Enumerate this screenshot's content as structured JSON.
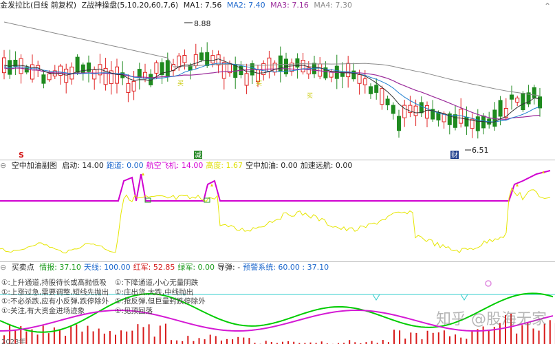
{
  "main_panel": {
    "stock_name": "金发拉比(日线 前复权)",
    "indicator": "Z战神操盘(5,10,20,60,7,6)",
    "ma1": "MA1: 7.56",
    "ma2": "MA2: 7.40",
    "ma3": "MA3: 7.16",
    "ma4": "MA4: 7.30",
    "high_label": "8.88",
    "low_label": "6.51",
    "marker_s": "S",
    "marker_jian": "减",
    "marker_cai": "财",
    "buy_mark": "买"
  },
  "sub_panel1": {
    "title": "空中加油副图",
    "items": [
      {
        "label": "启动: 14.00",
        "color": "#222222"
      },
      {
        "label": "跑道: 0.00",
        "color": "#1a66cc"
      },
      {
        "label": "航空飞机: 14.00",
        "color": "#d400d4"
      },
      {
        "label": "高度: 1.67",
        "color": "#dede00"
      },
      {
        "label": "空中加油: 0.00",
        "color": "#222222"
      },
      {
        "label": "加速远航: 0.00",
        "color": "#222222"
      }
    ]
  },
  "sub_panel2": {
    "title": "买卖点",
    "items": [
      {
        "label": "情报: 37.10",
        "color": "#1a9a1a"
      },
      {
        "label": "天线: 100.00",
        "color": "#1a66cc"
      },
      {
        "label": "红军: 52.85",
        "color": "#d41a1a"
      },
      {
        "label": "绿军: 0.00",
        "color": "#1a9a1a"
      },
      {
        "label": "导弹: -",
        "color": "#222222"
      },
      {
        "label": "预警系统: 60.00 : 37.10",
        "color": "#1a66cc"
      }
    ],
    "legend": [
      "①:上升通道,持股待长或高抛低吸",
      "①:下降通道,小心无量阴跌",
      "①:上涨过急,需要调整,短线先抛出",
      "①:庄出货,大跌,中线抛出",
      "①:不必杀跌,应有小反弹,跌停除外",
      "①:抢反弹,但巨量封跌停除外",
      "①:关注,有大资金进场迹象",
      "①:见顶回落"
    ],
    "bottom_axis": "2023年"
  },
  "watermark": "知乎 @股海无家",
  "colors": {
    "up": "#e02020",
    "down": "#1f8a1f",
    "ma_purple": "#9a2a9a",
    "ma_gray": "#8a8a8a",
    "ma_blue": "#2080d0",
    "yellow": "#e6e600",
    "magenta": "#d000d0",
    "green_line": "#00cc00",
    "cyan": "#33cccc"
  }
}
